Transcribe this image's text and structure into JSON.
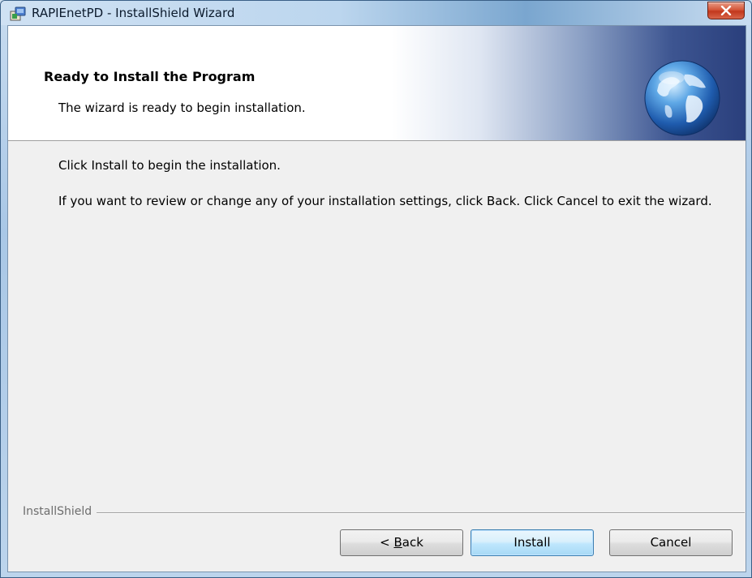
{
  "window": {
    "title": "RAPIEnetPD - InstallShield Wizard"
  },
  "banner": {
    "title": "Ready to Install the Program",
    "subtitle": "The wizard is ready to begin installation."
  },
  "content": {
    "line1": "Click Install to begin the installation.",
    "line2": "If you want to review or change any of your installation settings, click Back. Click Cancel to exit the wizard."
  },
  "footer": {
    "brand": "InstallShield",
    "back_prefix": "< ",
    "back_accel": "B",
    "back_rest": "ack",
    "install_label": "Install",
    "cancel_label": "Cancel"
  },
  "icons": {
    "app": "installer-app-icon",
    "close": "close-icon",
    "banner": "globe-icon"
  },
  "colors": {
    "banner_dark": "#2a3f7c",
    "close_red": "#c2371c",
    "default_button": "#3c7fb1"
  }
}
